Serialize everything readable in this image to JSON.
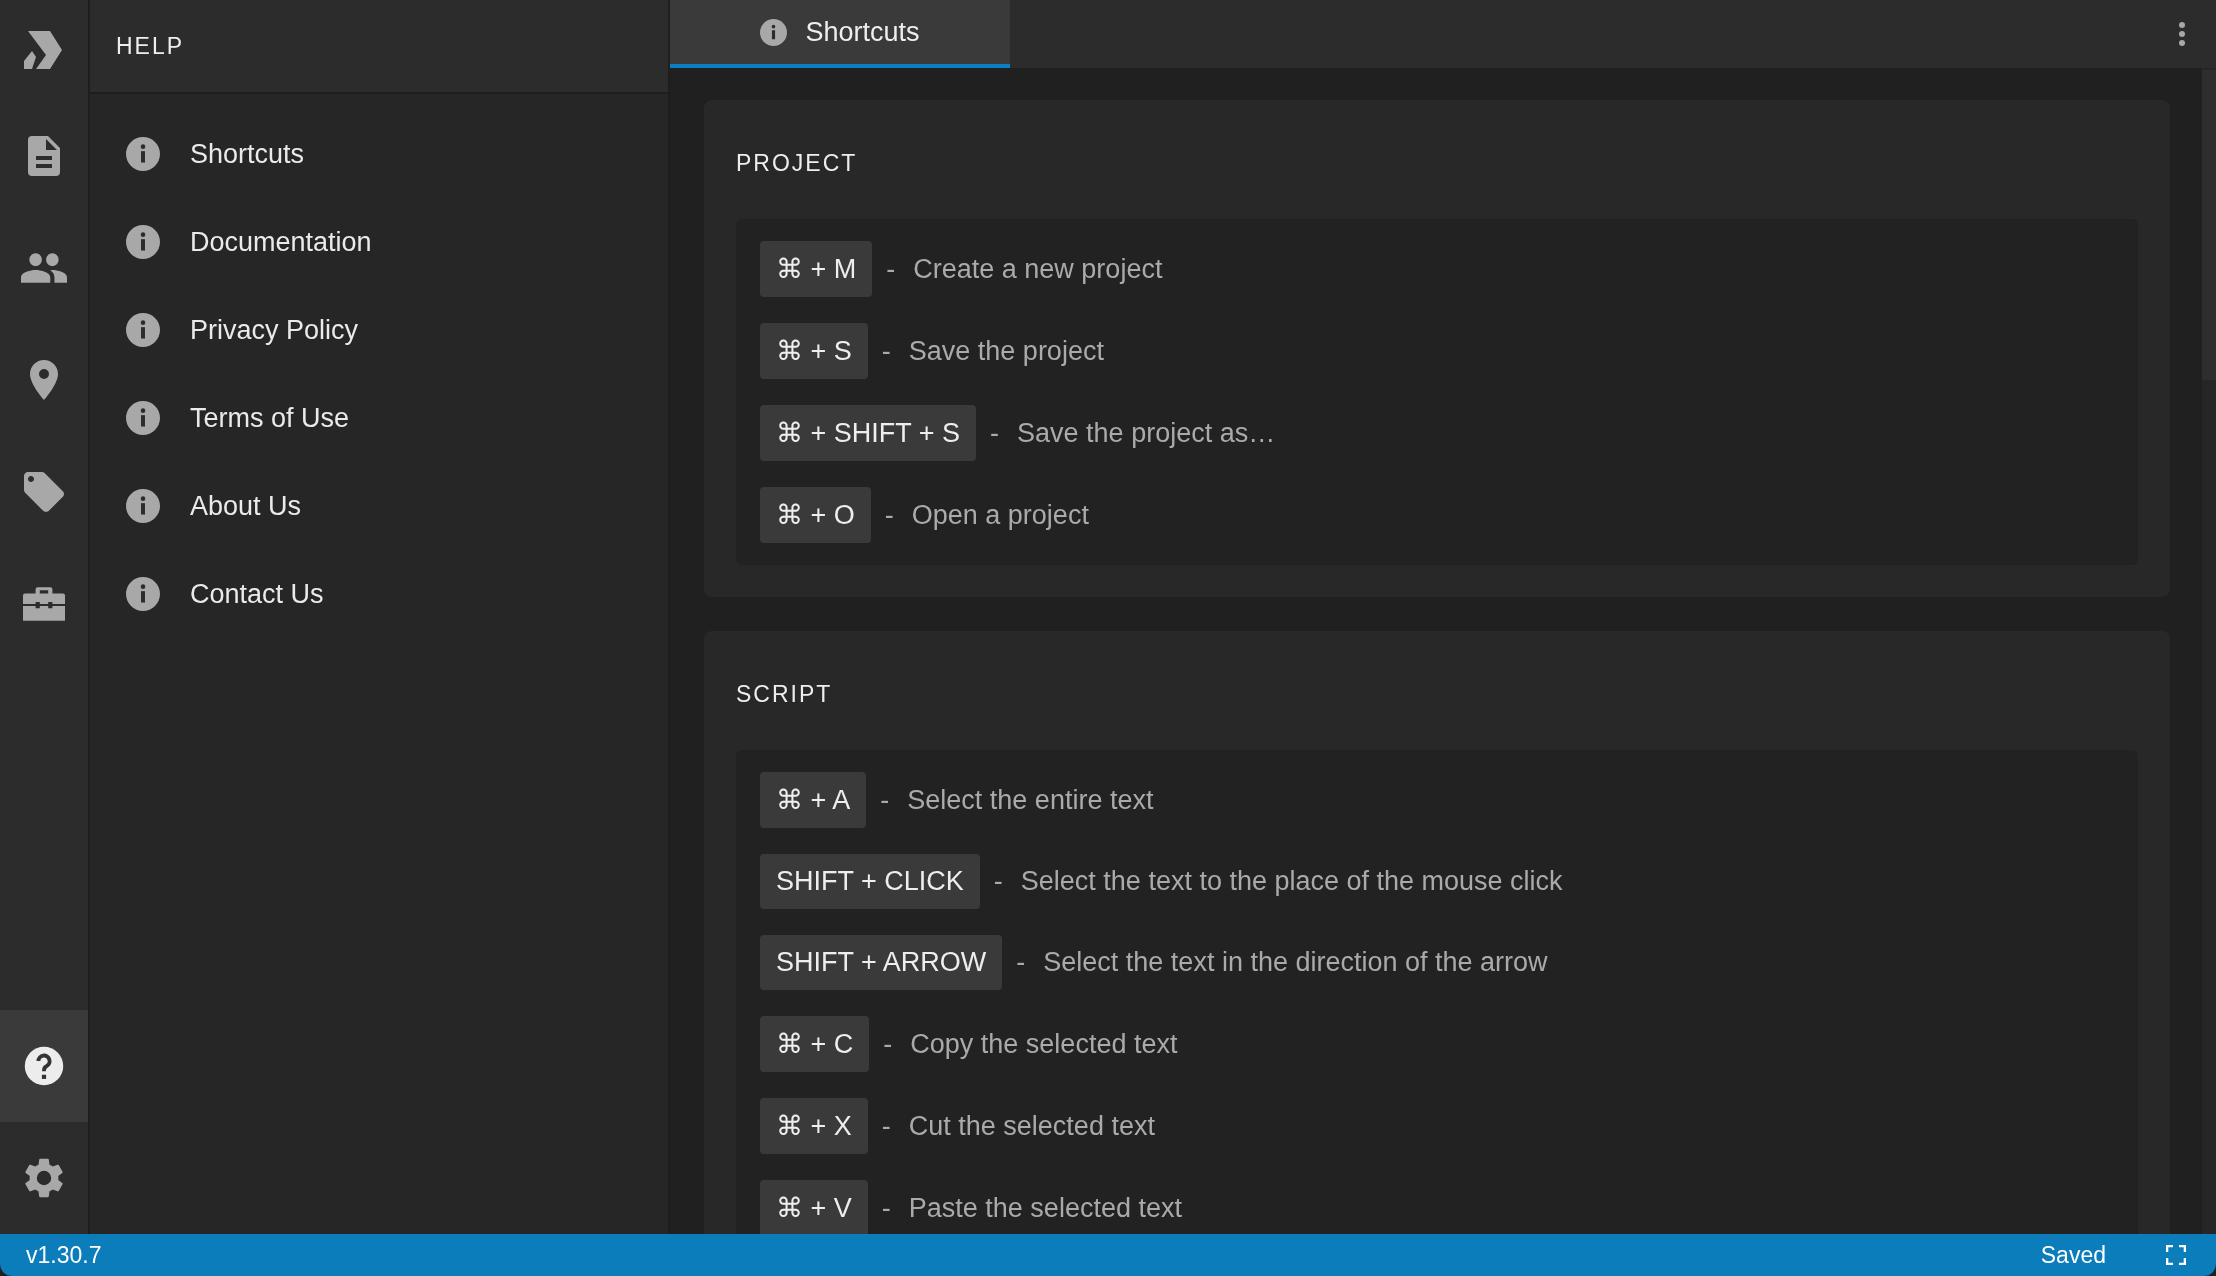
{
  "rail": {
    "items": [
      {
        "kind": "document",
        "selected": false
      },
      {
        "kind": "people",
        "selected": false
      },
      {
        "kind": "pin",
        "selected": false
      },
      {
        "kind": "tag",
        "selected": false
      },
      {
        "kind": "toolbox",
        "selected": false
      }
    ],
    "bottom_items": [
      {
        "kind": "help",
        "selected": true
      },
      {
        "kind": "settings",
        "selected": false
      }
    ]
  },
  "help_panel": {
    "title": "HELP",
    "items": [
      {
        "label": "Shortcuts"
      },
      {
        "label": "Documentation"
      },
      {
        "label": "Privacy Policy"
      },
      {
        "label": "Terms of Use"
      },
      {
        "label": "About Us"
      },
      {
        "label": "Contact Us"
      }
    ]
  },
  "tabs": [
    {
      "label": "Shortcuts",
      "selected": true
    }
  ],
  "sections": [
    {
      "title": "PROJECT",
      "shortcuts": [
        {
          "keys": "⌘ + M",
          "separator": "-",
          "description": "Create a new project"
        },
        {
          "keys": "⌘ + S",
          "separator": "-",
          "description": "Save the project"
        },
        {
          "keys": "⌘ + SHIFT + S",
          "separator": "-",
          "description": "Save the project as…"
        },
        {
          "keys": "⌘ + O",
          "separator": "-",
          "description": "Open a project"
        }
      ]
    },
    {
      "title": "SCRIPT",
      "shortcuts": [
        {
          "keys": "⌘ + A",
          "separator": "-",
          "description": "Select the entire text"
        },
        {
          "keys": "SHIFT + CLICK",
          "separator": "-",
          "description": "Select the text to the place of the mouse click"
        },
        {
          "keys": "SHIFT + ARROW",
          "separator": "-",
          "description": "Select the text in the direction of the arrow"
        },
        {
          "keys": "⌘ + C",
          "separator": "-",
          "description": "Copy the selected text"
        },
        {
          "keys": "⌘ + X",
          "separator": "-",
          "description": "Cut the selected text"
        },
        {
          "keys": "⌘ + V",
          "separator": "-",
          "description": "Paste the selected text"
        }
      ]
    }
  ],
  "status_bar": {
    "version": "v1.30.7",
    "status": "Saved"
  }
}
